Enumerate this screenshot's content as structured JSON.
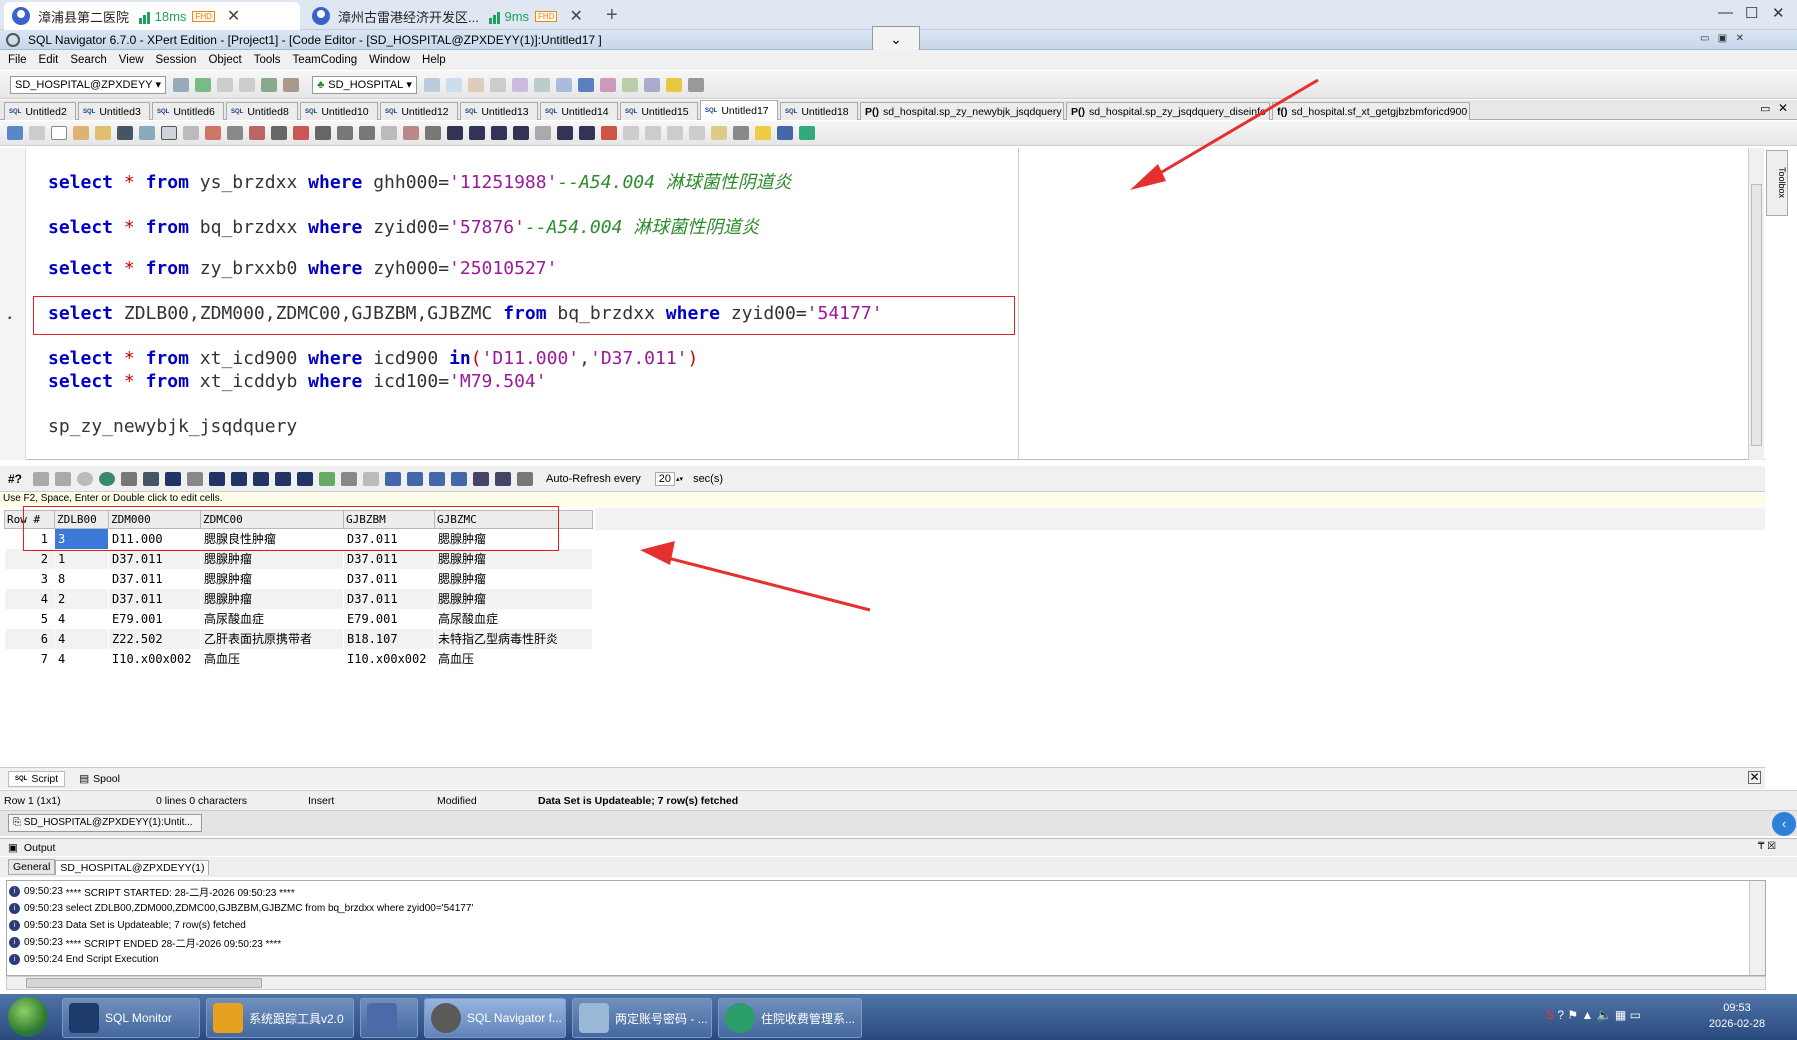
{
  "browser": {
    "tabs": [
      {
        "title": "漳浦县第二医院",
        "latency": "18ms",
        "badge": "FHD"
      },
      {
        "title": "漳州古雷港经济开发区...",
        "latency": "9ms",
        "badge": "FHD"
      }
    ]
  },
  "app": {
    "title": "SQL Navigator 6.7.0 - XPert Edition - [Project1] - [Code Editor - [SD_HOSPITAL@ZPXDEYY(1)]:Untitled17 ]"
  },
  "menu": [
    "File",
    "Edit",
    "Search",
    "View",
    "Session",
    "Object",
    "Tools",
    "TeamCoding",
    "Window",
    "Help"
  ],
  "toolbar": {
    "connection": "SD_HOSPITAL@ZPXDEYY",
    "schema": "SD_HOSPITAL"
  },
  "editor_tabs": [
    {
      "label": "Untitled2",
      "prefix": "SQL"
    },
    {
      "label": "Untitled3",
      "prefix": "SQL"
    },
    {
      "label": "Untitled6",
      "prefix": "SQL"
    },
    {
      "label": "Untitled8",
      "prefix": "SQL"
    },
    {
      "label": "Untitled10",
      "prefix": "SQL"
    },
    {
      "label": "Untitled12",
      "prefix": "SQL"
    },
    {
      "label": "Untitled13",
      "prefix": "SQL"
    },
    {
      "label": "Untitled14",
      "prefix": "SQL"
    },
    {
      "label": "Untitled15",
      "prefix": "SQL"
    },
    {
      "label": "Untitled17",
      "prefix": "SQL",
      "active": true
    },
    {
      "label": "Untitled18",
      "prefix": "SQL"
    },
    {
      "label": "sd_hospital.sp_zy_newybjk_jsqdquery",
      "prefix": "P()"
    },
    {
      "label": "sd_hospital.sp_zy_jsqdquery_diseinfo",
      "prefix": "P()"
    },
    {
      "label": "sd_hospital.sf_xt_getgjbzbmforicd900",
      "prefix": "f()"
    }
  ],
  "code": {
    "l1": {
      "kw1": "select",
      "star": "*",
      "kw2": "from",
      "tbl": "ys_brzdxx",
      "kw3": "where",
      "col": "ghh000=",
      "val": "'11251988'",
      "cm": "--A54.004 淋球菌性阴道炎"
    },
    "l2": {
      "kw1": "select",
      "star": "*",
      "kw2": "from",
      "tbl": "bq_brzdxx",
      "kw3": "where",
      "col": "zyid00=",
      "val": "'57876'",
      "cm": "--A54.004 淋球菌性阴道炎"
    },
    "l3": {
      "kw1": "select",
      "star": "*",
      "kw2": "from",
      "tbl": "zy_brxxb0",
      "kw3": "where",
      "col": "zyh000=",
      "val": "'25010527'"
    },
    "l4": {
      "kw1": "select",
      "cols": "ZDLB00,ZDM000,ZDMC00,GJBZBM,GJBZMC",
      "kw2": "from",
      "tbl": "bq_brzdxx",
      "kw3": "where",
      "col": "zyid00=",
      "val": "'54177'"
    },
    "l5": {
      "kw1": "select",
      "star": "*",
      "kw2": "from",
      "tbl": "xt_icd900",
      "kw3": "where",
      "col": "icd900",
      "kw4": "in",
      "p1": "(",
      "v1": "'D11.000'",
      "c": ",",
      "v2": "'D37.011'",
      "p2": ")"
    },
    "l6": {
      "kw1": "select",
      "star": "*",
      "kw2": "from",
      "tbl": "xt_icddyb",
      "kw3": "where",
      "col": "icd100=",
      "val": "'M79.504'"
    },
    "l7": {
      "text": "sp_zy_newybjk_jsqdquery"
    }
  },
  "results_toolbar": {
    "hash": "#?",
    "auto_refresh": "Auto-Refresh every",
    "interval": "20",
    "unit": "sec(s)"
  },
  "results_hint": "Use F2, Space, Enter or Double click to edit cells.",
  "grid": {
    "columns": [
      "Row #",
      "ZDLB00",
      "ZDM000",
      "ZDMC00",
      "GJBZBM",
      "GJBZMC"
    ],
    "rows": [
      [
        "1",
        "3",
        "D11.000",
        "腮腺良性肿瘤",
        "D37.011",
        "腮腺肿瘤"
      ],
      [
        "2",
        "1",
        "D37.011",
        "腮腺肿瘤",
        "D37.011",
        "腮腺肿瘤"
      ],
      [
        "3",
        "8",
        "D37.011",
        "腮腺肿瘤",
        "D37.011",
        "腮腺肿瘤"
      ],
      [
        "4",
        "2",
        "D37.011",
        "腮腺肿瘤",
        "D37.011",
        "腮腺肿瘤"
      ],
      [
        "5",
        "4",
        "E79.001",
        "高尿酸血症",
        "E79.001",
        "高尿酸血症"
      ],
      [
        "6",
        "4",
        "Z22.502",
        "乙肝表面抗原携带者",
        "B18.107",
        "未特指乙型病毒性肝炎"
      ],
      [
        "7",
        "4",
        "I10.x00x002",
        "高血压",
        "I10.x00x002",
        "高血压"
      ]
    ]
  },
  "bottom_tabs": {
    "script": "Script",
    "spool": "Spool"
  },
  "status": {
    "pos": "Row 1 (1x1)",
    "lines": "0 lines 0 characters",
    "mode": "Insert",
    "modified": "Modified",
    "msg": "Data Set is Updateable; 7 row(s) fetched"
  },
  "window_button": "SD_HOSPITAL@ZPXDEYY(1):Untit...",
  "output": {
    "title": "Output",
    "tabs": [
      "General",
      "SD_HOSPITAL@ZPXDEYY(1)"
    ],
    "lines": [
      {
        "time": "09:50:23",
        "text": "**** SCRIPT STARTED: 28-二月-2026 09:50:23 ****"
      },
      {
        "time": "09:50:23",
        "text": "select ZDLB00,ZDM000,ZDMC00,GJBZBM,GJBZMC from bq_brzdxx where zyid00='54177'"
      },
      {
        "time": "09:50:23",
        "text": "Data Set is Updateable; 7 row(s) fetched"
      },
      {
        "time": "09:50:23",
        "text": "**** SCRIPT ENDED 28-二月-2026 09:50:23 ****"
      },
      {
        "time": "09:50:24",
        "text": "End Script Execution"
      }
    ]
  },
  "taskbar": {
    "tasks": [
      "SQL Monitor",
      "系统跟踪工具v2.0",
      "",
      "SQL Navigator f...",
      "两定账号密码 - ...",
      "住院收费管理系..."
    ],
    "time": "09:53",
    "date": "2026-02-28"
  },
  "colors": {
    "keyword": "#0000c8",
    "string": "#9a1b9a",
    "comment": "#2e8b2e",
    "highlight_box": "#e02020",
    "arrow": "#e53030"
  }
}
